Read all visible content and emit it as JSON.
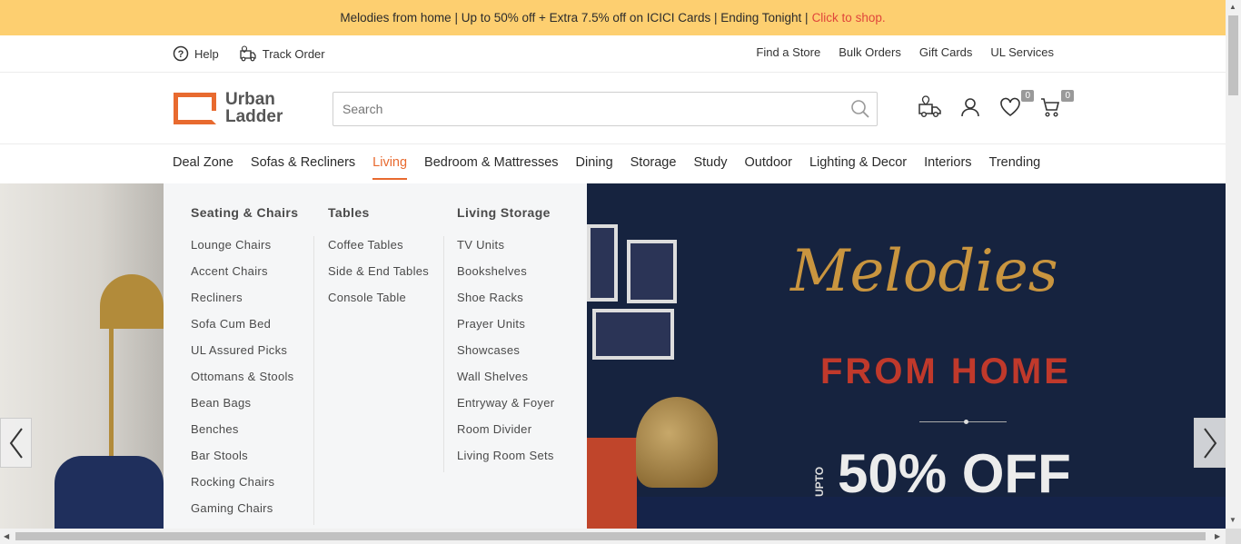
{
  "promo": {
    "text": "Melodies from home | Up to 50% off + Extra 7.5% off on ICICI Cards | Ending Tonight |",
    "cta": "Click to shop.",
    "accent": "#e0463b",
    "background": "#fdcf70"
  },
  "util": {
    "help": "Help",
    "track": "Track Order",
    "right": [
      "Find a Store",
      "Bulk Orders",
      "Gift Cards",
      "UL Services"
    ]
  },
  "header": {
    "logo_line1": "Urban",
    "logo_line2": "Ladder",
    "search_placeholder": "Search",
    "wishlist_count": "0",
    "cart_count": "0",
    "brand_color": "#e86a2f"
  },
  "nav": {
    "items": [
      "Deal Zone",
      "Sofas & Recliners",
      "Living",
      "Bedroom & Mattresses",
      "Dining",
      "Storage",
      "Study",
      "Outdoor",
      "Lighting & Decor",
      "Interiors",
      "Trending"
    ],
    "active": "Living"
  },
  "mega": {
    "col1": {
      "title": "Seating & Chairs",
      "items": [
        "Lounge Chairs",
        "Accent Chairs",
        "Recliners",
        "Sofa Cum Bed",
        "UL Assured Picks",
        "Ottomans & Stools",
        "Bean Bags",
        "Benches",
        "Bar Stools",
        "Rocking Chairs",
        "Gaming Chairs"
      ]
    },
    "col2": {
      "title": "Tables",
      "items": [
        "Coffee Tables",
        "Side & End Tables",
        "Console Table"
      ]
    },
    "col3": {
      "title": "Living Storage",
      "items": [
        "TV Units",
        "Bookshelves",
        "Shoe Racks",
        "Prayer Units",
        "Showcases",
        "Wall Shelves",
        "Entryway & Foyer",
        "Room Divider",
        "Living Room Sets"
      ]
    }
  },
  "hero": {
    "title": "Melodies",
    "subtitle": "FROM HOME",
    "upto": "UPTO",
    "offer": "50% OFF"
  }
}
